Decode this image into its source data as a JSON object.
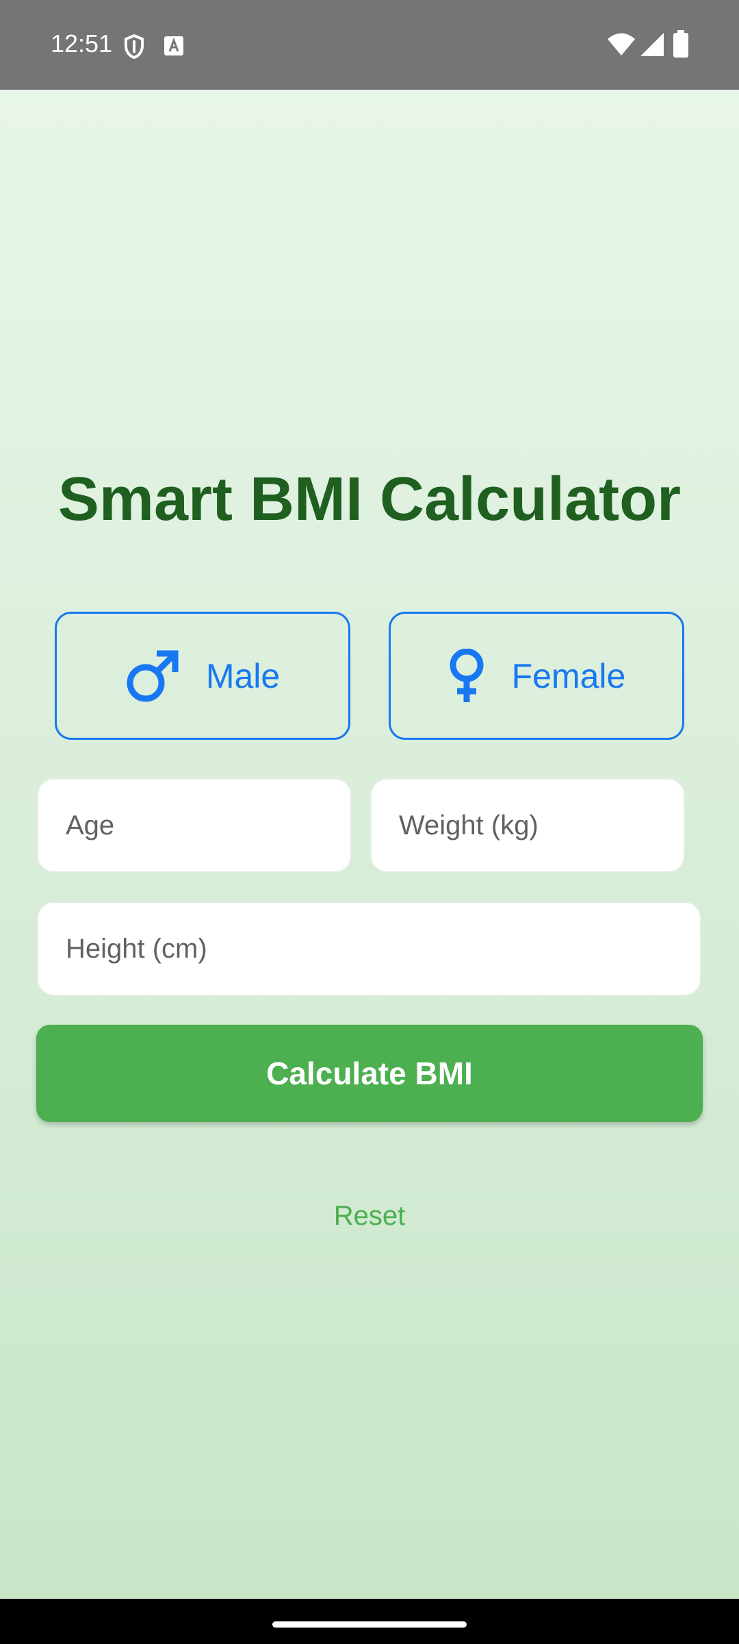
{
  "status_bar": {
    "time": "12:51",
    "icons": [
      "shield-icon",
      "font-notification-icon",
      "wifi-icon",
      "cellular-signal-icon",
      "battery-icon"
    ]
  },
  "app": {
    "title": "Smart BMI Calculator",
    "gender": {
      "male_label": "Male",
      "female_label": "Female",
      "male_icon": "male-symbol-icon",
      "female_icon": "female-symbol-icon"
    },
    "inputs": {
      "age": {
        "placeholder": "Age",
        "value": ""
      },
      "weight": {
        "placeholder": "Weight (kg)",
        "value": ""
      },
      "height": {
        "placeholder": "Height (cm)",
        "value": ""
      }
    },
    "calculate_label": "Calculate BMI",
    "reset_label": "Reset"
  },
  "colors": {
    "title": "#1f5f20",
    "accent_blue": "#1877f2",
    "primary_green": "#4caf50",
    "status_bar": "#757575"
  }
}
